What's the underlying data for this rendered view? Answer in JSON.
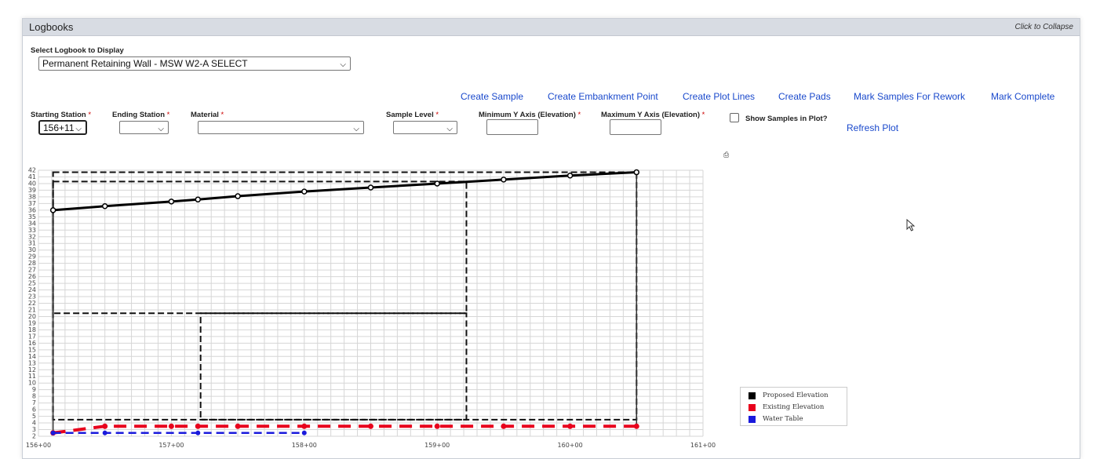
{
  "panel": {
    "title": "Logbooks",
    "collapse_label": "Click to Collapse"
  },
  "logbook": {
    "label": "Select Logbook to Display",
    "selected": "Permanent Retaining Wall - MSW W2-A SELECT"
  },
  "actions": [
    "Create Sample",
    "Create Embankment Point",
    "Create Plot Lines",
    "Create Pads",
    "Mark Samples For Rework",
    "Mark Complete"
  ],
  "filters": {
    "starting_station": {
      "label": "Starting Station",
      "value": "156+11"
    },
    "ending_station": {
      "label": "Ending Station",
      "value": ""
    },
    "material": {
      "label": "Material",
      "value": ""
    },
    "sample_level": {
      "label": "Sample Level",
      "value": ""
    },
    "min_y": {
      "label": "Minimum Y Axis (Elevation)",
      "value": ""
    },
    "max_y": {
      "label": "Maximum Y Axis (Elevation)",
      "value": ""
    },
    "required_mark": "*",
    "show_samples_label": "Show Samples in Plot?",
    "show_samples_checked": false,
    "refresh_label": "Refresh Plot"
  },
  "icons": {
    "print": "printer-icon",
    "cursor": "mouse-cursor-icon"
  },
  "chart_data": {
    "type": "line",
    "x_ticks": [
      "156+00",
      "157+00",
      "158+00",
      "159+00",
      "160+00",
      "161+00"
    ],
    "xlim": [
      156.0,
      161.0
    ],
    "ylim": [
      2,
      42
    ],
    "y_ticks": [
      2,
      3,
      4,
      5,
      6,
      7,
      8,
      9,
      10,
      11,
      12,
      13,
      14,
      15,
      16,
      17,
      18,
      19,
      20,
      21,
      22,
      23,
      24,
      25,
      26,
      27,
      28,
      29,
      30,
      31,
      32,
      33,
      34,
      35,
      36,
      37,
      38,
      39,
      40,
      41,
      42
    ],
    "grid": true,
    "legend_position": "bottom-right",
    "series": [
      {
        "name": "Proposed Elevation",
        "color": "#000000",
        "x": [
          156.11,
          156.5,
          157.0,
          157.2,
          157.5,
          158.0,
          158.5,
          159.0,
          159.5,
          160.0,
          160.5
        ],
        "y": [
          36.0,
          36.6,
          37.3,
          37.6,
          38.1,
          38.8,
          39.4,
          40.0,
          40.6,
          41.2,
          41.7
        ]
      },
      {
        "name": "Existing Elevation",
        "color": "#e8001c",
        "x": [
          156.11,
          156.5,
          157.0,
          157.2,
          157.5,
          158.0,
          158.5,
          159.0,
          159.5,
          160.0,
          160.5
        ],
        "y": [
          2.5,
          3.5,
          3.5,
          3.5,
          3.5,
          3.5,
          3.5,
          3.5,
          3.5,
          3.5,
          3.5
        ]
      },
      {
        "name": "Water Table",
        "color": "#1a1adc",
        "x": [
          156.11,
          156.5,
          157.2,
          158.0
        ],
        "y": [
          2.5,
          2.5,
          2.5,
          2.5
        ]
      }
    ],
    "pads": [
      {
        "x0": 156.11,
        "x1": 160.5,
        "y0": 4.5,
        "y1": 41.7
      },
      {
        "x0": 156.11,
        "x1": 159.22,
        "y0": 20.5,
        "y1": 40.3
      },
      {
        "x0": 157.22,
        "x1": 159.22,
        "y0": 4.5,
        "y1": 20.5
      }
    ]
  }
}
